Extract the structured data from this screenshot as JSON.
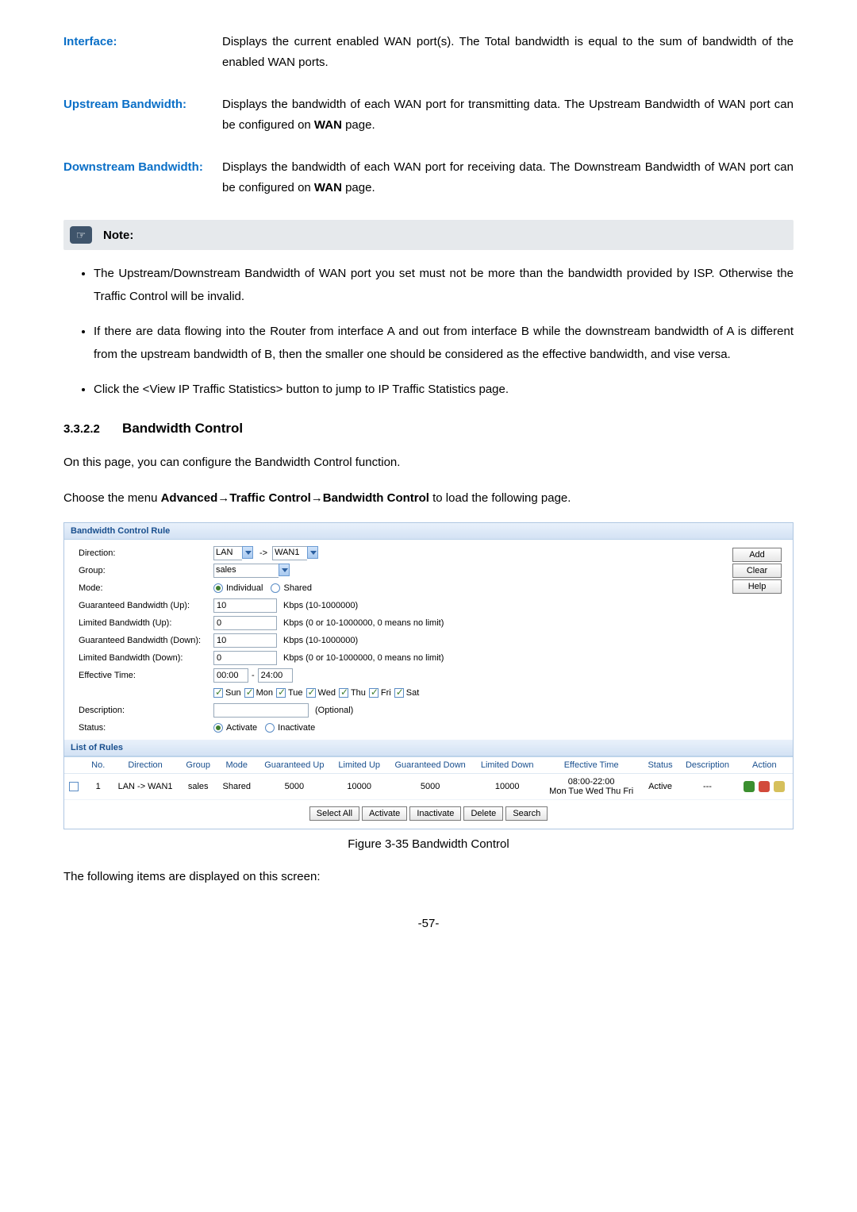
{
  "defs": {
    "interface": {
      "term": "Interface:",
      "desc": "Displays the current enabled WAN port(s). The Total bandwidth is equal to the sum of bandwidth of the enabled WAN ports."
    },
    "upstream": {
      "term": "Upstream Bandwidth:",
      "desc_part1": "Displays the bandwidth of each WAN port for transmitting data. The Upstream Bandwidth of WAN port can be configured on ",
      "desc_bold": "WAN",
      "desc_part2": " page."
    },
    "downstream": {
      "term": "Downstream Bandwidth:",
      "desc_part1": "Displays the bandwidth of each WAN port for receiving data. The Downstream Bandwidth of WAN port can be configured on ",
      "desc_bold": "WAN",
      "desc_part2": " page."
    }
  },
  "note_label": "Note:",
  "note_bullets": [
    "The Upstream/Downstream Bandwidth of WAN port you set must not be more than the bandwidth provided by ISP. Otherwise the Traffic Control will be invalid.",
    "If there are data flowing into the Router from interface A and out from interface B while the downstream bandwidth of A is different from the upstream bandwidth of B, then the smaller one should be considered as the effective bandwidth, and vise versa.",
    "Click the <View IP Traffic Statistics> button to jump to IP Traffic Statistics page."
  ],
  "section": {
    "num": "3.3.2.2",
    "title": "Bandwidth Control"
  },
  "intro": "On this page, you can configure the Bandwidth Control function.",
  "nav_line": {
    "pre": "Choose the menu ",
    "b1": "Advanced",
    "arrow": "→",
    "b2": "Traffic Control",
    "b3": "Bandwidth Control",
    "post": " to load the following page."
  },
  "shot": {
    "bar_rule": "Bandwidth Control Rule",
    "direction_label": "Direction:",
    "direction_from": "LAN",
    "direction_arrow": "->",
    "direction_to": "WAN1",
    "group_label": "Group:",
    "group_value": "sales",
    "mode_label": "Mode:",
    "mode_individual": "Individual",
    "mode_shared": "Shared",
    "gbw_up_label": "Guaranteed Bandwidth (Up):",
    "gbw_up_value": "10",
    "kbps_range": "Kbps (10-1000000)",
    "lbw_up_label": "Limited Bandwidth (Up):",
    "lbw_up_value": "0",
    "kbps_range0": "Kbps (0 or 10-1000000, 0 means no limit)",
    "gbw_dn_label": "Guaranteed Bandwidth (Down):",
    "gbw_dn_value": "10",
    "lbw_dn_label": "Limited Bandwidth (Down):",
    "lbw_dn_value": "0",
    "eff_label": "Effective Time:",
    "eff_from": "00:00",
    "eff_dash": "-",
    "eff_to": "24:00",
    "days": [
      "Sun",
      "Mon",
      "Tue",
      "Wed",
      "Thu",
      "Fri",
      "Sat"
    ],
    "desc_label": "Description:",
    "desc_hint": "(Optional)",
    "status_label": "Status:",
    "status_act": "Activate",
    "status_inact": "Inactivate",
    "btn_add": "Add",
    "btn_clear": "Clear",
    "btn_help": "Help",
    "list_bar": "List of Rules",
    "cols": [
      "",
      "No.",
      "Direction",
      "Group",
      "Mode",
      "Guaranteed Up",
      "Limited Up",
      "Guaranteed Down",
      "Limited Down",
      "Effective Time",
      "Status",
      "Description",
      "Action"
    ],
    "row": {
      "no": "1",
      "dir": "LAN -> WAN1",
      "group": "sales",
      "mode": "Shared",
      "gu": "5000",
      "lu": "10000",
      "gd": "5000",
      "ld": "10000",
      "time": "08:00-22:00",
      "days": "Mon Tue Wed Thu Fri",
      "status": "Active",
      "desc": "---"
    },
    "row_btns": [
      "Select All",
      "Activate",
      "Inactivate",
      "Delete",
      "Search"
    ]
  },
  "figure_caption": "Figure 3-35 Bandwidth Control",
  "closing": "The following items are displayed on this screen:",
  "page_num": "-57-"
}
